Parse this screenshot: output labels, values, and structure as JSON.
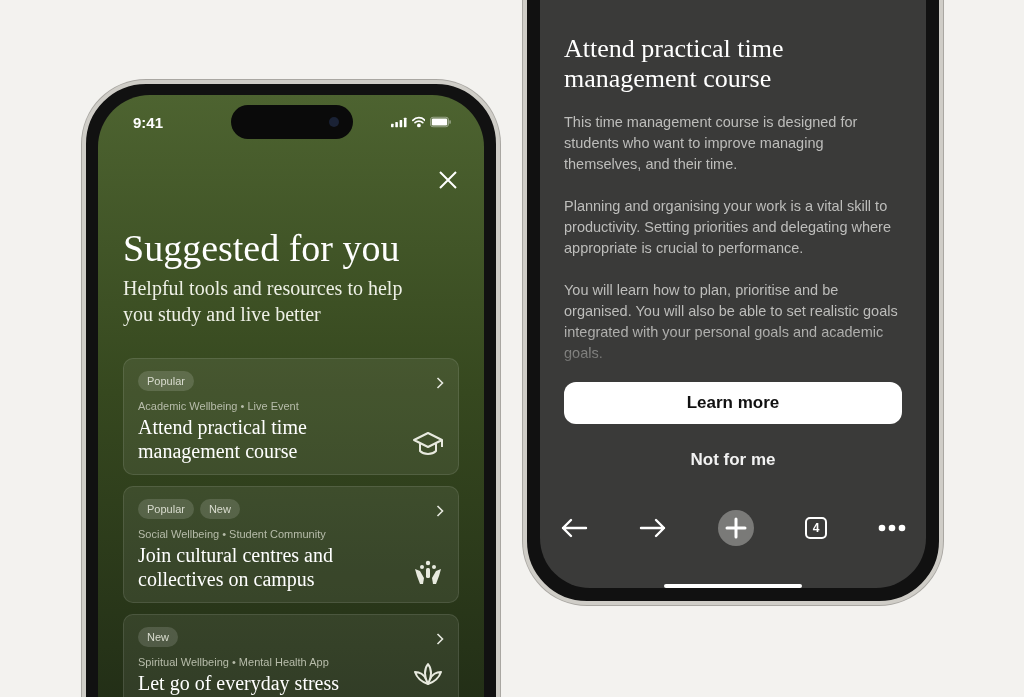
{
  "left_phone": {
    "status_bar": {
      "time": "9:41"
    },
    "heading": "Suggested for you",
    "subheading": "Helpful tools and resources to help you study and live better",
    "suggestions": [
      {
        "tags": [
          "Popular"
        ],
        "category": "Academic Wellbeing • Live Event",
        "title": "Attend practical time management course"
      },
      {
        "tags": [
          "Popular",
          "New"
        ],
        "category": "Social Wellbeing • Student Community",
        "title": "Join cultural centres and collectives on campus"
      },
      {
        "tags": [
          "New"
        ],
        "category": "Spiritual Wellbeing • Mental Health App",
        "title": "Let go of everyday stress"
      }
    ]
  },
  "right_phone": {
    "title": "Attend practical time management course",
    "paragraphs": [
      "This time management course is designed for students who want to improve managing themselves, and their time.",
      "Planning and organising your work is a vital skill to productivity. Setting priorities and delegating where appropriate is crucial to performance.",
      "You will learn how to plan, prioritise and be organised. You will also be able to set realistic goals integrated with your personal goals and academic goals."
    ],
    "primary_button": "Learn more",
    "secondary_button": "Not for me",
    "toolbar": {
      "tab_count": "4"
    }
  }
}
